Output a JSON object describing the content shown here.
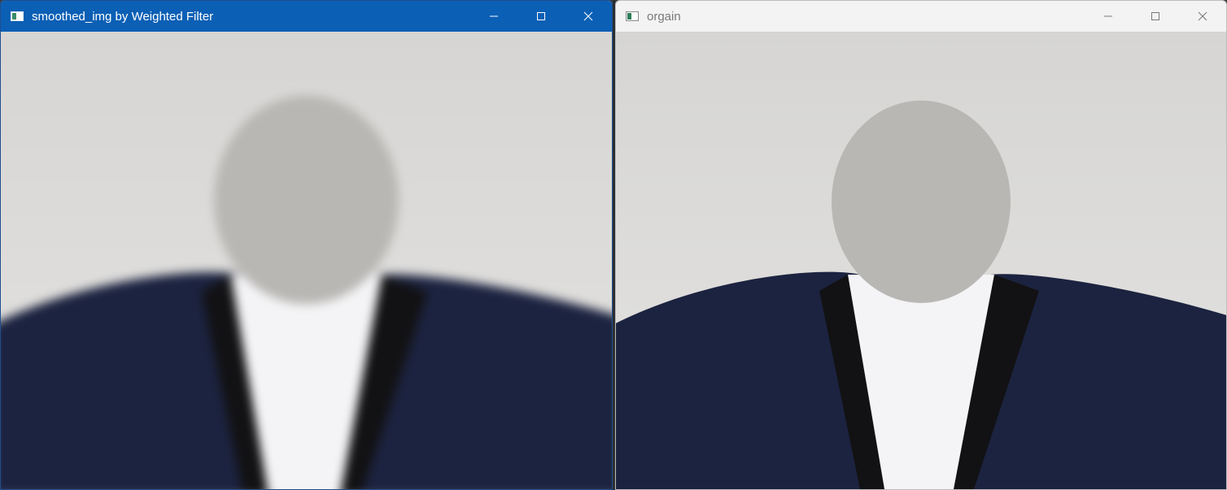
{
  "windows": [
    {
      "title": "smoothed_img by Weighted Filter",
      "state": "active",
      "controls": [
        "minimize-icon",
        "maximize-icon",
        "close-icon"
      ],
      "content": "weighted-filter-smoothed-image"
    },
    {
      "title": "orgain",
      "state": "inactive",
      "controls": [
        "minimize-icon",
        "maximize-icon",
        "close-icon"
      ],
      "content": "original-image"
    }
  ],
  "colors": {
    "active_titlebar": "#0b5fb5",
    "inactive_titlebar": "#f3f3f3",
    "background": "#d9d8d6",
    "suit": "#1c2340",
    "lapel": "#121214",
    "shirt": "#f4f4f6"
  }
}
